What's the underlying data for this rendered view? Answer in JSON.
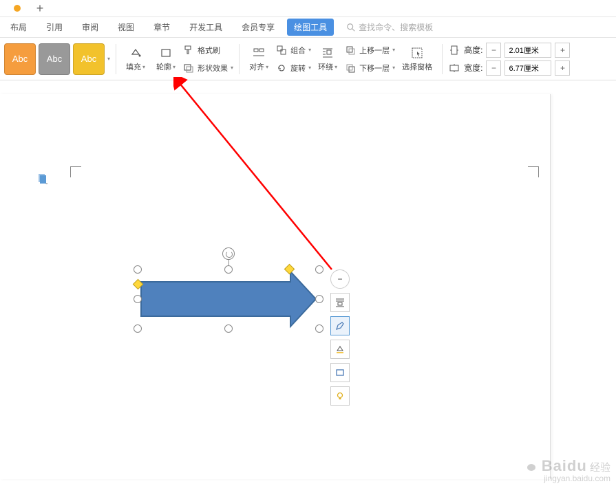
{
  "tabs": {
    "plus": "+"
  },
  "menu": {
    "items": [
      "布局",
      "引用",
      "审阅",
      "视图",
      "章节",
      "开发工具",
      "会员专享",
      "绘图工具"
    ],
    "active_index": 7
  },
  "search": {
    "placeholder": "查找命令、搜索模板"
  },
  "ribbon": {
    "styles": [
      "Abc",
      "Abc",
      "Abc"
    ],
    "fill": "填充",
    "outline": "轮廓",
    "format_painter": "格式刷",
    "shape_effect": "形状效果",
    "align": "对齐",
    "group": "组合",
    "rotate": "旋转",
    "wrap": "环绕",
    "bring_forward": "上移一层",
    "send_backward": "下移一层",
    "select_pane": "选择窗格",
    "height_label": "高度:",
    "height_value": "2.01厘米",
    "width_label": "宽度:",
    "width_value": "6.77厘米"
  },
  "float_toolbar": {
    "collapse": "−"
  },
  "watermark": {
    "brand": "Baidu",
    "suffix": "经验",
    "url": "jingyan.baidu.com"
  }
}
